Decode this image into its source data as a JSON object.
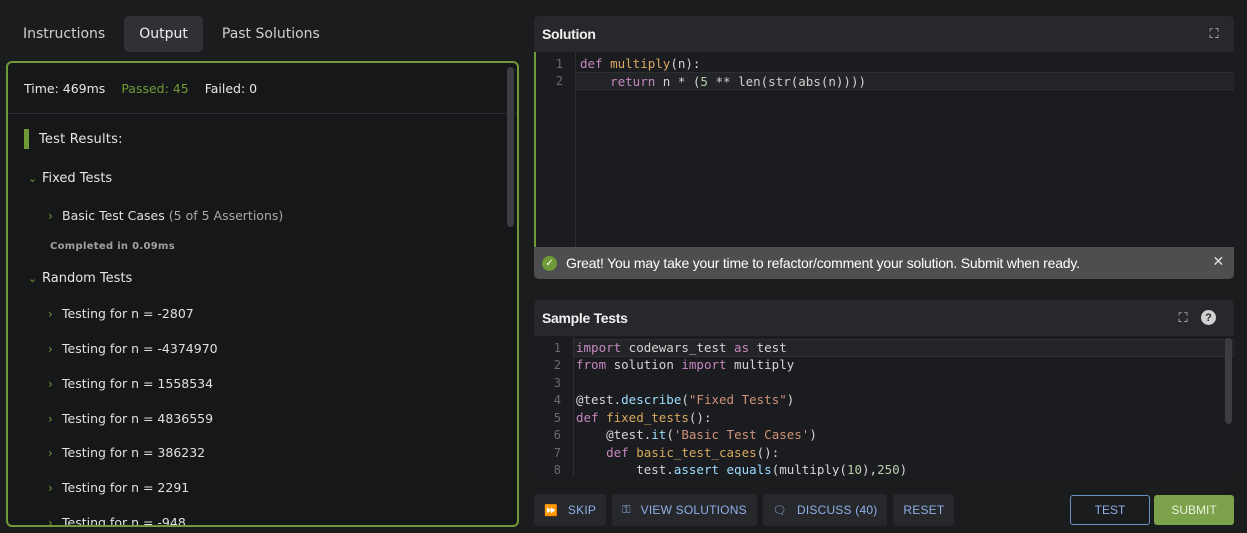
{
  "tabs": [
    {
      "label": "Instructions"
    },
    {
      "label": "Output"
    },
    {
      "label": "Past Solutions"
    }
  ],
  "stats": {
    "time": "Time: 469ms",
    "passed": "Passed: 45",
    "failed": "Failed: 0"
  },
  "results": {
    "header": "Test Results:",
    "fixed_group": "Fixed Tests",
    "basic_case": "Basic Test Cases",
    "basic_case_sub": "(5 of 5 Assertions)",
    "completed": "Completed in 0.09ms",
    "random_group": "Random Tests",
    "random_items": [
      "Testing for n = -2807",
      "Testing for n = -4374970",
      "Testing for n = 1558534",
      "Testing for n = 4836559",
      "Testing for n = 386232",
      "Testing for n = 2291",
      "Testing for n = -948"
    ]
  },
  "solution": {
    "title": "Solution",
    "line_numbers": [
      "1",
      "2"
    ],
    "banner": "Great! You may take your time to refactor/comment your solution. Submit when ready."
  },
  "sample_tests": {
    "title": "Sample Tests",
    "line_numbers": [
      "1",
      "2",
      "3",
      "4",
      "5",
      "6",
      "7",
      "8"
    ]
  },
  "actions": {
    "skip": "SKIP",
    "view_solutions": "VIEW SOLUTIONS",
    "discuss": "DISCUSS (40)",
    "reset": "RESET",
    "test": "TEST",
    "submit": "SUBMIT"
  },
  "colors": {
    "accent_green": "#6f9a37",
    "link_blue": "#8fb0e8",
    "submit_bg": "#7ba14b"
  }
}
